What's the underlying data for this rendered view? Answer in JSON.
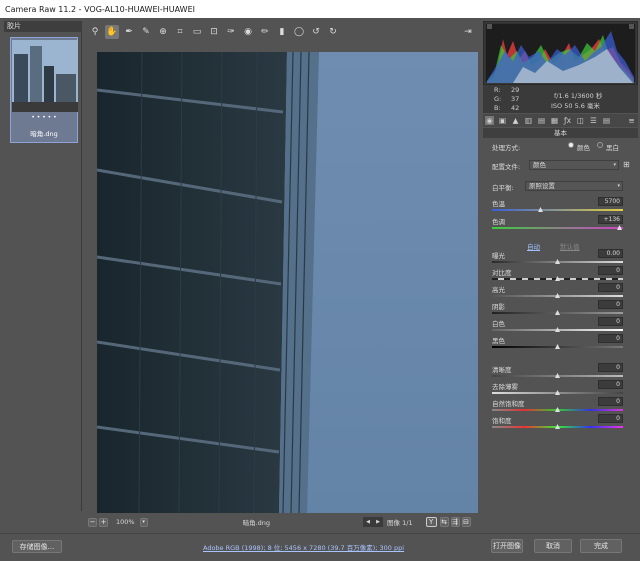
{
  "window": {
    "title": "Camera Raw 11.2 -  VOG-AL10-HUAWEI-HUAWEI"
  },
  "filmstrip": {
    "title": "胶片",
    "thumb_stars": "• • • • •",
    "thumb_name": "暗角.dng"
  },
  "toolbar": {
    "icons": [
      "zoom-icon",
      "hand-icon",
      "white-balance-icon",
      "color-sampler-icon",
      "target-adjust-icon",
      "crop-icon",
      "straighten-icon",
      "transform-icon",
      "spot-removal-icon",
      "red-eye-icon",
      "adjustment-brush-icon",
      "graduated-filter-icon",
      "radial-filter-icon",
      "rotate-left-icon",
      "rotate-right-icon"
    ],
    "export_icon": "open-in-photoshop-icon"
  },
  "preview": {
    "zoom": "100%",
    "filename": "暗角.dng",
    "image_label": "图像 1/1",
    "y_label": "Y"
  },
  "readout": {
    "r_label": "R:",
    "r": "29",
    "g_label": "G:",
    "g": "37",
    "b_label": "B:",
    "b": "42",
    "exposure": "f/1.6  1/3600 秒",
    "iso": "ISO 50  5.6 毫米"
  },
  "panel": {
    "section": "基本",
    "process_label": "处理方式:",
    "color_option": "颜色",
    "bw_option": "黑白",
    "profile_label": "配置文件:",
    "profile_value": "颜色",
    "wb_label": "白平衡:",
    "wb_value": "原照设置",
    "temp_label": "色温",
    "temp_value": "5700",
    "tint_label": "色调",
    "tint_value": "+136",
    "auto": "自动",
    "default": "默认值",
    "sliders": [
      {
        "label": "曝光",
        "value": "0.00"
      },
      {
        "label": "对比度",
        "value": "0"
      },
      {
        "label": "高光",
        "value": "0"
      },
      {
        "label": "阴影",
        "value": "0"
      },
      {
        "label": "白色",
        "value": "0"
      },
      {
        "label": "黑色",
        "value": "0"
      }
    ],
    "sliders2": [
      {
        "label": "清晰度",
        "value": "0"
      },
      {
        "label": "去除薄雾",
        "value": "0"
      },
      {
        "label": "自然饱和度",
        "value": "0"
      },
      {
        "label": "饱和度",
        "value": "0"
      }
    ]
  },
  "bottom": {
    "save": "存储图像...",
    "info": "Adobe RGB (1998); 8 位; 5456 x 7280 (39.7 百万像素); 300 ppi",
    "open": "打开图像",
    "cancel": "取消",
    "done": "完成"
  },
  "colors": {
    "accent": "#8ea4d6",
    "sky": "#6b88aa",
    "building": "#1f2c33"
  }
}
